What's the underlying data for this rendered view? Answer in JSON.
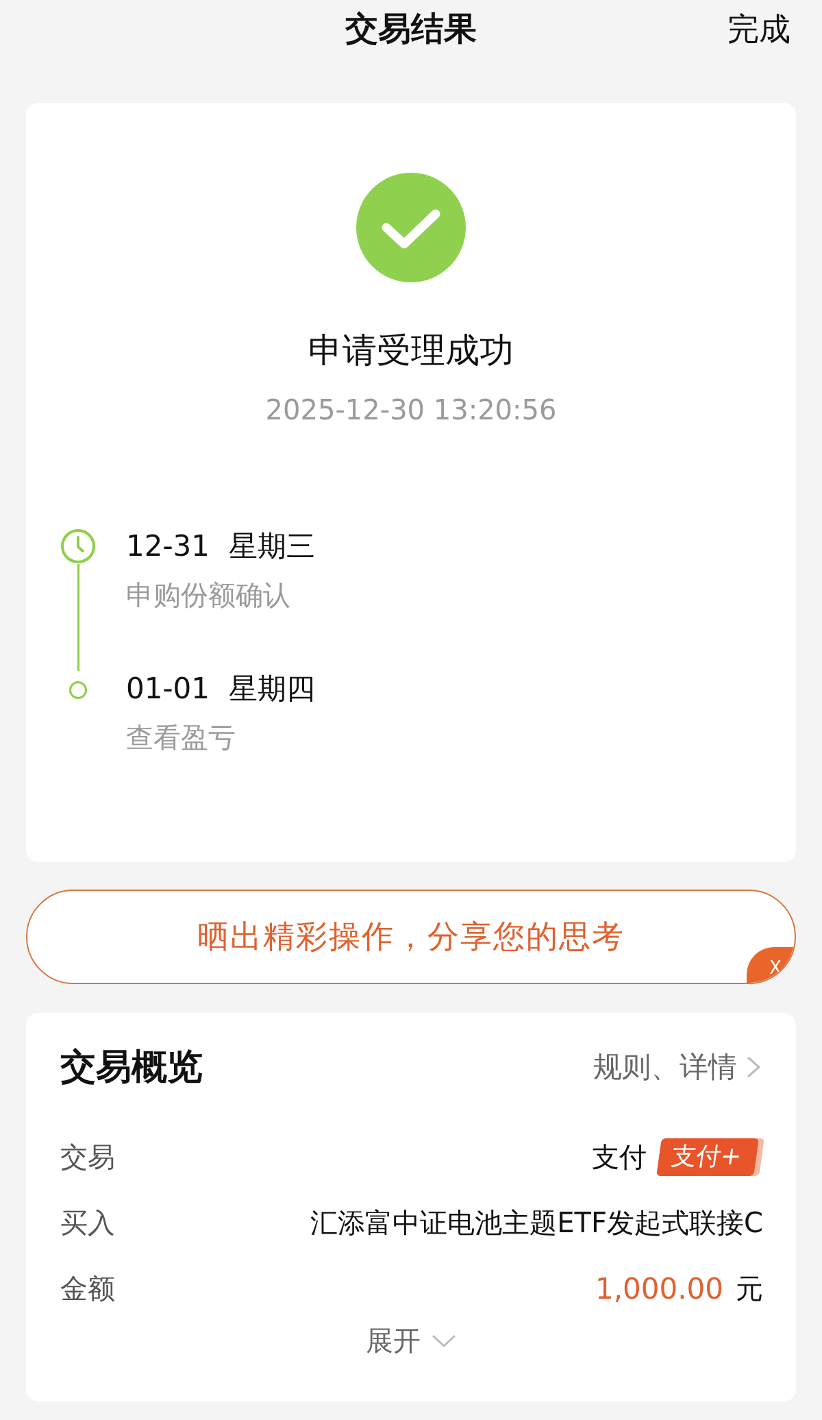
{
  "header": {
    "title": "交易结果",
    "done": "完成"
  },
  "result": {
    "title": "申请受理成功",
    "time": "2025-12-30 13:20:56"
  },
  "timeline": [
    {
      "kind": "clock",
      "date": "12-31",
      "weekday": "星期三",
      "desc": "申购份额确认"
    },
    {
      "kind": "dot",
      "date": "01-01",
      "weekday": "星期四",
      "desc": "查看盈亏"
    }
  ],
  "share_banner": {
    "text": "晒出精彩操作，分享您的思考",
    "close": "X"
  },
  "overview": {
    "title": "交易概览",
    "link": "规则、详情",
    "rows": [
      {
        "kind": "badge",
        "label": "交易",
        "value": "支付",
        "badge": "支付+"
      },
      {
        "kind": "text",
        "label": "买入",
        "value": "汇添富中证电池主题ETF发起式联接C"
      },
      {
        "kind": "amount",
        "label": "金额",
        "value": "1,000.00",
        "unit": "元"
      }
    ],
    "expand": "展开"
  }
}
